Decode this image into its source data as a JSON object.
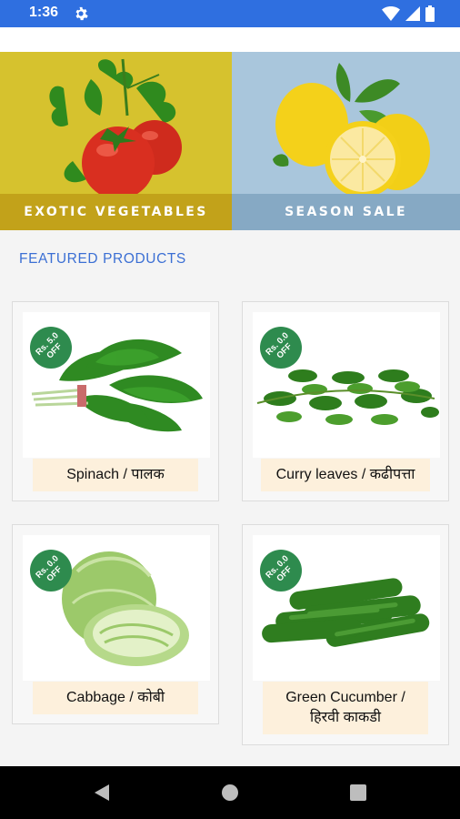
{
  "status_bar": {
    "time": "1:36",
    "icons": [
      "gear-icon",
      "wifi-icon",
      "signal-icon",
      "battery-icon"
    ],
    "background": "#2f6fe0"
  },
  "banners": [
    {
      "caption": "EXOTIC VEGETABLES",
      "image": "tomato-image",
      "background": "#d6c22e"
    },
    {
      "caption": "SEASON SALE",
      "image": "lemon-image",
      "background": "#a9c6dc"
    }
  ],
  "section_title": "FEATURED PRODUCTS",
  "products": [
    {
      "name": "Spinach / पालक",
      "badge_amount": "Rs. 5.0",
      "badge_off": "OFF",
      "image": "spinach-image"
    },
    {
      "name": "Curry leaves / कढीपत्ता",
      "badge_amount": "Rs. 0.0",
      "badge_off": "OFF",
      "image": "curry-leaves-image"
    },
    {
      "name": "Cabbage / कोबी",
      "badge_amount": "Rs. 0.0",
      "badge_off": "OFF",
      "image": "cabbage-image"
    },
    {
      "name": "Green Cucumber / हिरवी काकडी",
      "badge_amount": "Rs. 0.0",
      "badge_off": "OFF",
      "image": "cucumber-image"
    }
  ],
  "nav_bar": {
    "buttons": [
      "back-icon",
      "home-icon",
      "recents-icon"
    ]
  },
  "colors": {
    "accent": "#3b6fd4",
    "badge": "#2e8b4e",
    "name_bg": "#fdf0dc"
  }
}
